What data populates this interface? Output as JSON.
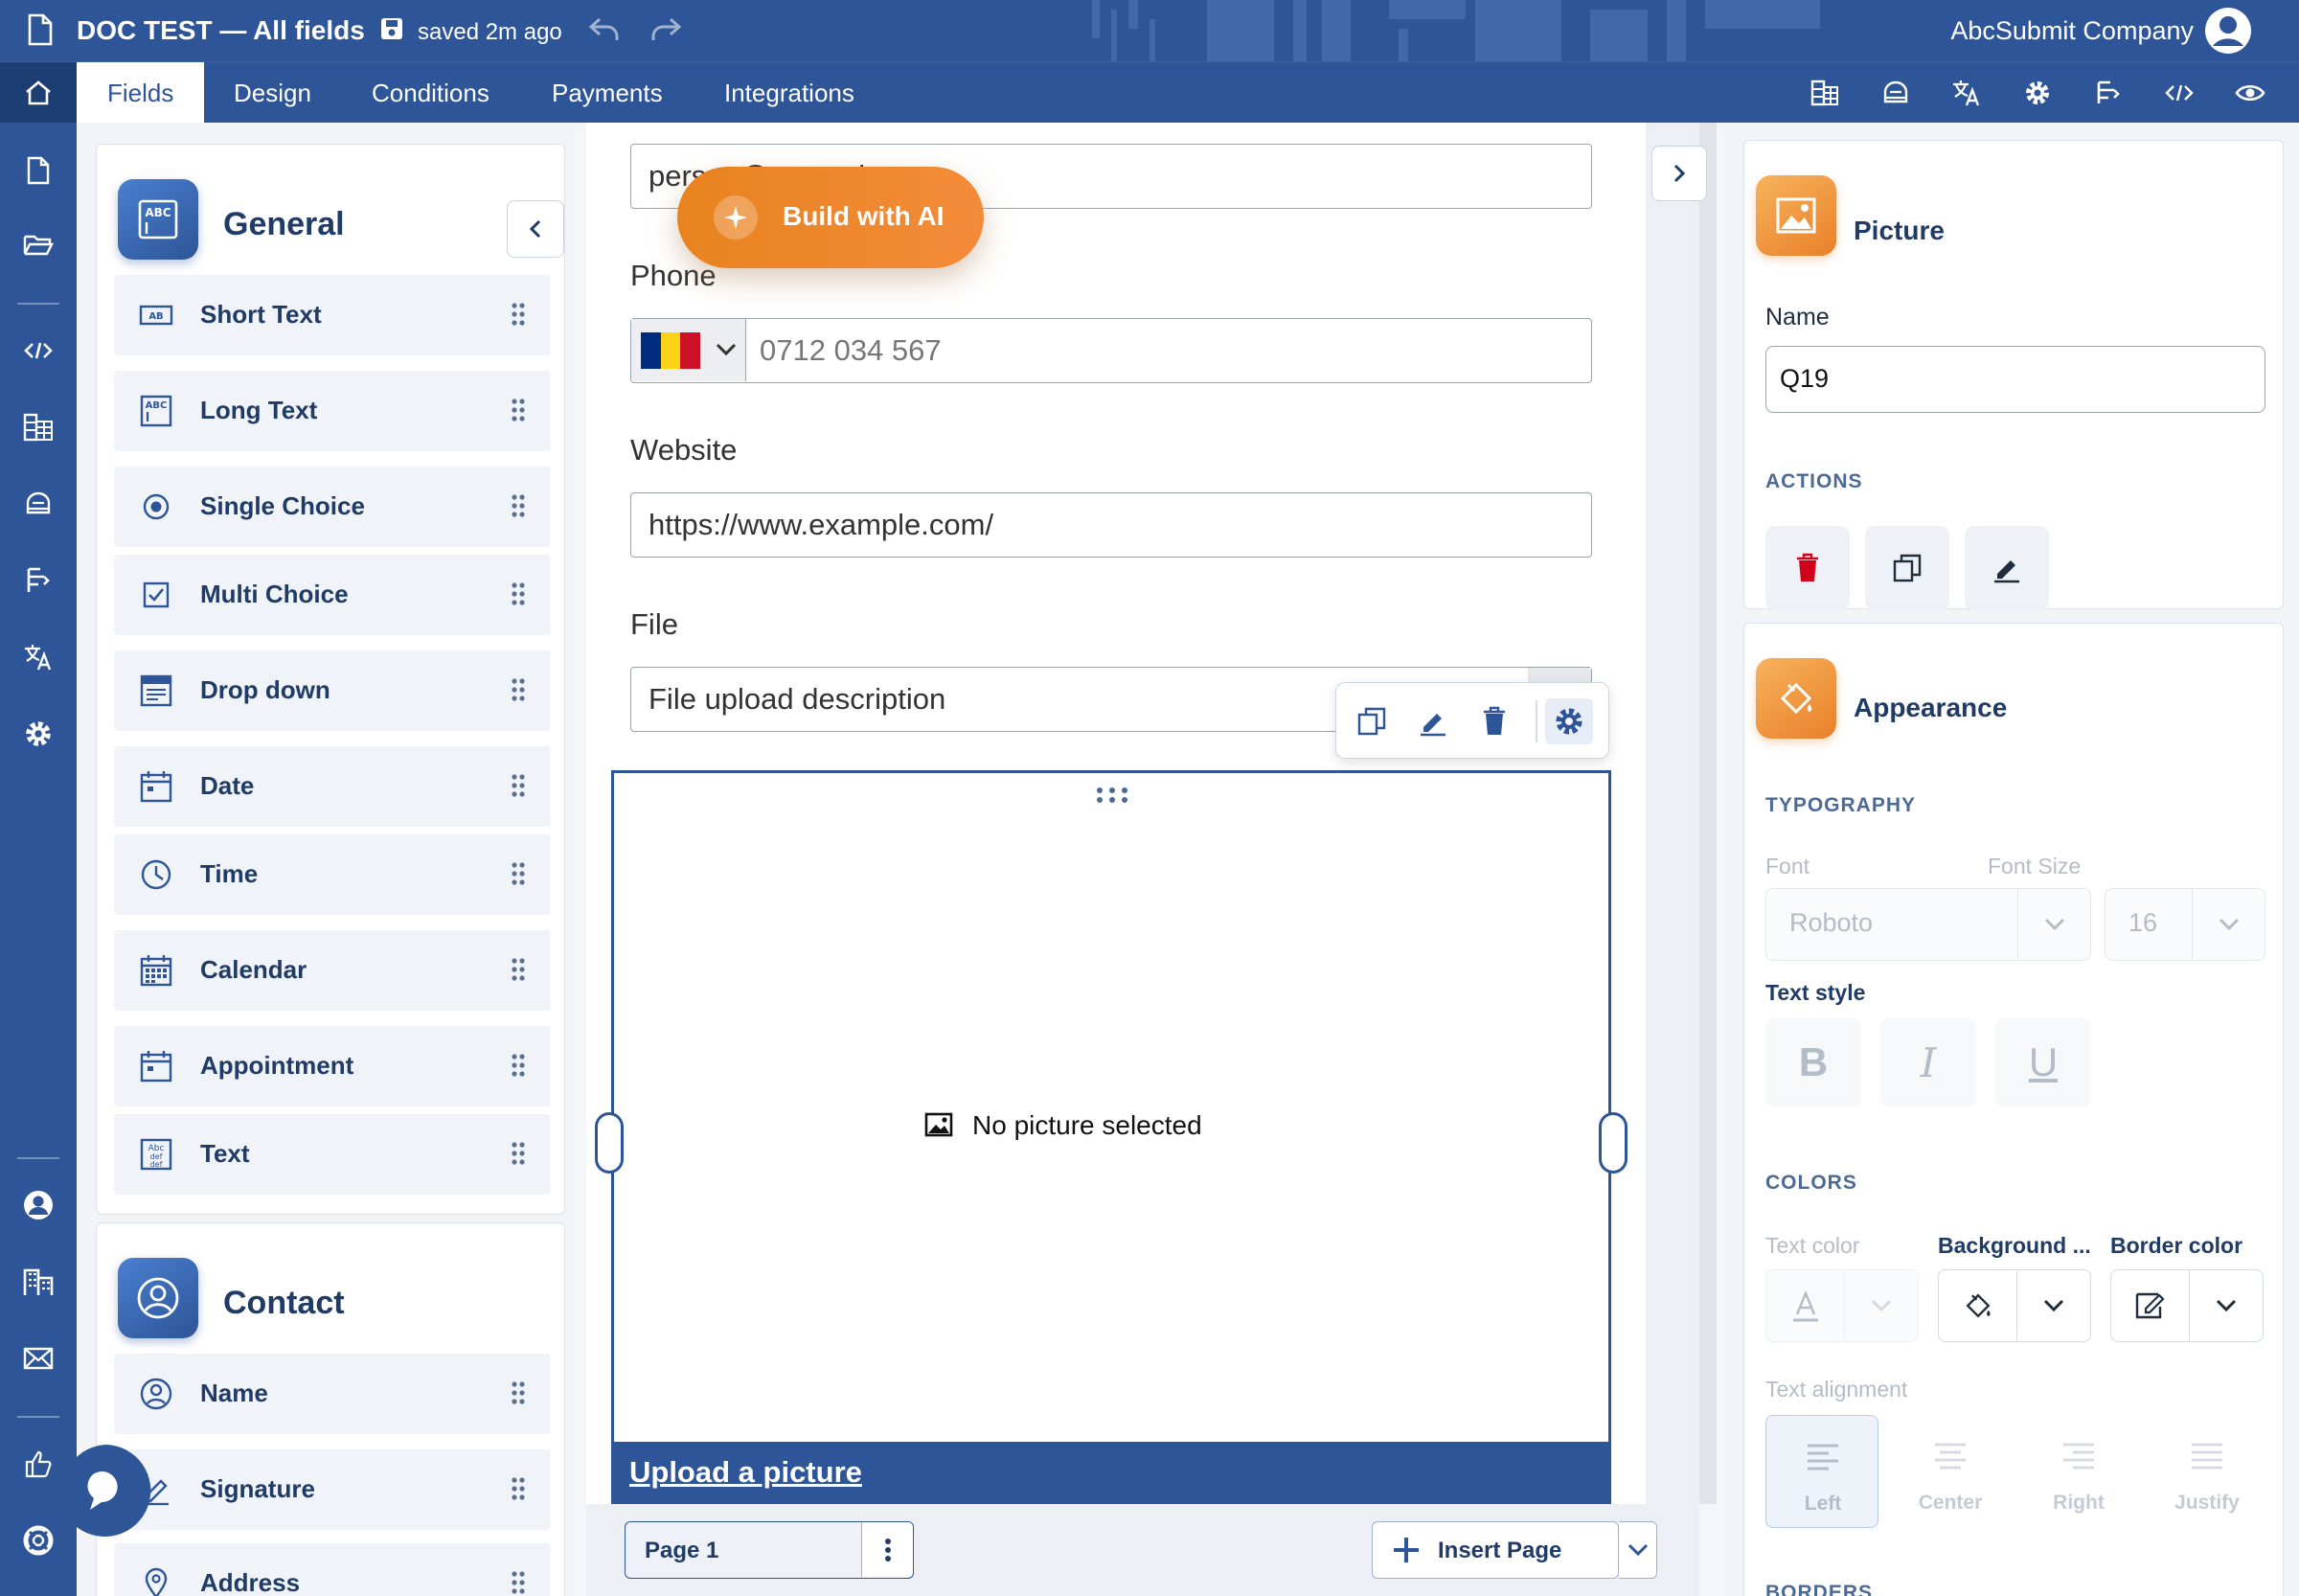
{
  "header": {
    "doc_title": "DOC TEST — All fields",
    "saved_status": "saved 2m ago",
    "company": "AbcSubmit Company"
  },
  "nav": {
    "tabs": [
      {
        "label": "Fields",
        "active": true
      },
      {
        "label": "Design",
        "active": false
      },
      {
        "label": "Conditions",
        "active": false
      },
      {
        "label": "Payments",
        "active": false
      },
      {
        "label": "Integrations",
        "active": false
      }
    ],
    "right_icons": [
      "table-icon",
      "database-icon",
      "translate-icon",
      "settings-icon",
      "flow-icon",
      "code-icon",
      "preview-eye-icon"
    ]
  },
  "rail": {
    "icons": [
      "file-icon",
      "folder-open-icon",
      "code-icon",
      "table-icon",
      "database-icon",
      "flow-icon",
      "translate-icon",
      "settings-icon",
      "user-icon",
      "building-icon",
      "mail-icon",
      "thumbs-up-icon",
      "support-icon"
    ]
  },
  "left_panel": {
    "general": {
      "title": "General",
      "items": [
        {
          "label": "Short Text",
          "icon": "short-text-icon"
        },
        {
          "label": "Long Text",
          "icon": "long-text-icon"
        },
        {
          "label": "Single Choice",
          "icon": "radio-icon"
        },
        {
          "label": "Multi Choice",
          "icon": "checkbox-icon"
        },
        {
          "label": "Drop down",
          "icon": "dropdown-icon"
        },
        {
          "label": "Date",
          "icon": "date-icon"
        },
        {
          "label": "Time",
          "icon": "clock-icon"
        },
        {
          "label": "Calendar",
          "icon": "calendar-icon"
        },
        {
          "label": "Appointment",
          "icon": "appointment-icon"
        },
        {
          "label": "Text",
          "icon": "text-block-icon"
        }
      ]
    },
    "contact": {
      "title": "Contact",
      "items": [
        {
          "label": "Name",
          "icon": "person-icon"
        },
        {
          "label": "Signature",
          "icon": "signature-icon"
        },
        {
          "label": "Address",
          "icon": "location-icon"
        }
      ]
    }
  },
  "form": {
    "email_value": "person@example.com",
    "build_ai_label": "Build with AI",
    "phone_label": "Phone",
    "phone_placeholder": "0712 034 567",
    "website_label": "Website",
    "website_value": "https://www.example.com/",
    "file_label": "File",
    "file_placeholder": "File upload description",
    "picture_empty": "No picture selected",
    "upload_link": "Upload a picture"
  },
  "pagebar": {
    "page_label": "Page 1",
    "insert_label": "Insert Page"
  },
  "right_panel": {
    "picture_title": "Picture",
    "name_label": "Name",
    "name_value": "Q19",
    "actions_label": "ACTIONS",
    "appearance_title": "Appearance",
    "typography_label": "TYPOGRAPHY",
    "font_label": "Font",
    "font_value": "Roboto",
    "font_size_label": "Font Size",
    "font_size_value": "16",
    "text_style_label": "Text style",
    "colors_label": "COLORS",
    "text_color_label": "Text color",
    "background_label": "Background ...",
    "border_color_label": "Border color",
    "text_alignment_label": "Text alignment",
    "align_left": "Left",
    "align_center": "Center",
    "align_right": "Right",
    "align_justify": "Justify",
    "borders_label": "BORDERS"
  },
  "colors": {
    "brand": "#2d5597",
    "accent_orange": "#e9802a",
    "delete_red": "#d0021b"
  }
}
